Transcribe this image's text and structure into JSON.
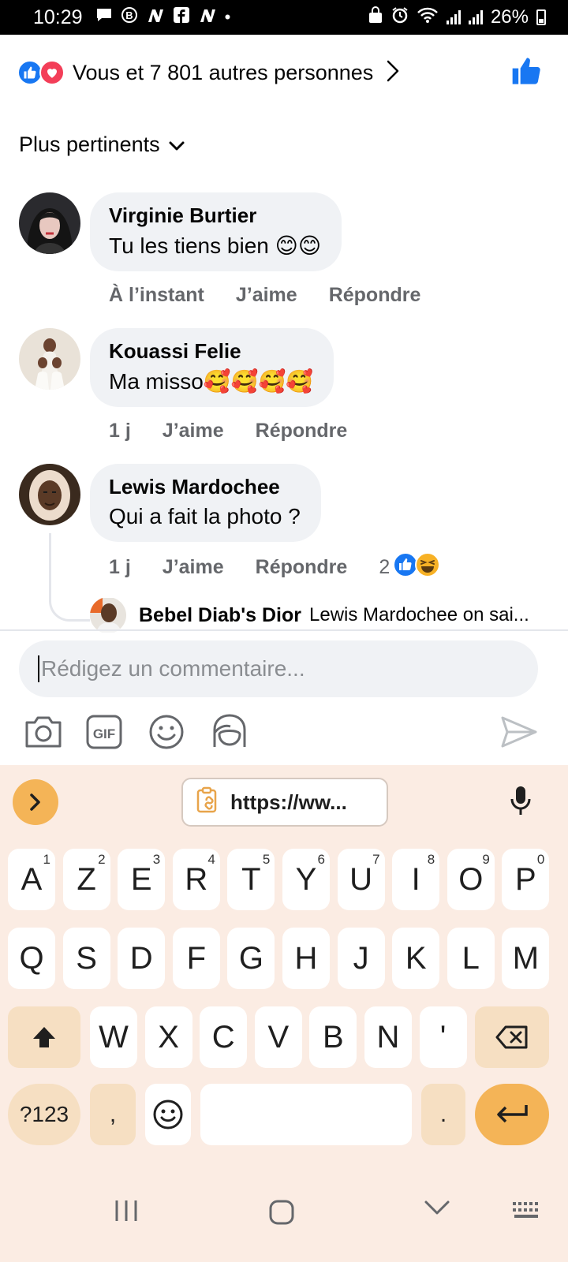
{
  "status_bar": {
    "time": "10:29",
    "battery": "26%",
    "notif_icons": [
      "message-icon",
      "b-icon",
      "n-icon",
      "f-icon",
      "n-icon",
      "dot"
    ]
  },
  "reactions": {
    "summary": "Vous et 7 801 autres personnes"
  },
  "sort": {
    "label": "Plus pertinents"
  },
  "comments": [
    {
      "author": "Virginie Burtier",
      "text": "Tu les tiens bien 😊😊",
      "time": "À l’instant",
      "like": "J’aime",
      "reply": "Répondre"
    },
    {
      "author": "Kouassi Felie",
      "text": "Ma misso🥰🥰🥰🥰",
      "time": "1 j",
      "like": "J’aime",
      "reply": "Répondre"
    },
    {
      "author": "Lewis Mardochee",
      "text": "Qui a fait la photo ?",
      "time": "1 j",
      "like": "J’aime",
      "reply": "Répondre",
      "reaction_count": "2"
    }
  ],
  "reply_preview": {
    "author": "Bebel Diab's Dior",
    "text": "Lewis Mardochee on sai..."
  },
  "composer": {
    "placeholder": "Rédigez un commentaire..."
  },
  "keyboard": {
    "clipboard_chip": "https://ww...",
    "row1": [
      {
        "k": "A",
        "s": "1"
      },
      {
        "k": "Z",
        "s": "2"
      },
      {
        "k": "E",
        "s": "3"
      },
      {
        "k": "R",
        "s": "4"
      },
      {
        "k": "T",
        "s": "5"
      },
      {
        "k": "Y",
        "s": "6"
      },
      {
        "k": "U",
        "s": "7"
      },
      {
        "k": "I",
        "s": "8"
      },
      {
        "k": "O",
        "s": "9"
      },
      {
        "k": "P",
        "s": "0"
      }
    ],
    "row2": [
      "Q",
      "S",
      "D",
      "F",
      "G",
      "H",
      "J",
      "K",
      "L",
      "M"
    ],
    "row3": [
      "W",
      "X",
      "C",
      "V",
      "B",
      "N",
      "'"
    ],
    "sym_label": "?123",
    "comma": ",",
    "period": "."
  },
  "colors": {
    "facebook_blue": "#1877f2",
    "love_red": "#f33e58",
    "bubble_gray": "#f0f2f5",
    "meta_gray": "#65676b",
    "keyboard_bg": "#fbece3",
    "key_accent": "#f4b457"
  }
}
